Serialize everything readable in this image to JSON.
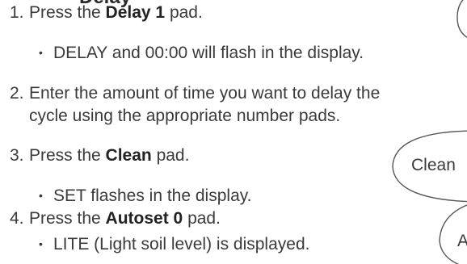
{
  "heading": {
    "fragment": "Delay"
  },
  "steps": [
    {
      "number": "1.",
      "prefix": "Press the ",
      "bold": "Delay 1",
      "suffix": " pad.",
      "bullet": "DELAY and 00:00 will flash in the display."
    },
    {
      "number": "2.",
      "line1": "Enter the amount of time you want to delay the",
      "line2": "cycle using the appropriate number pads."
    },
    {
      "number": "3.",
      "prefix": "Press the ",
      "bold": "Clean",
      "suffix": " pad.",
      "bullet": "SET flashes in the display."
    },
    {
      "number": "4.",
      "prefix": "Press the ",
      "bold": "Autoset 0",
      "suffix": " pad.",
      "bullet": "LITE (Light soil level) is displayed."
    }
  ],
  "pads": {
    "clean_label": "Clean",
    "autoset_fragment": "A"
  }
}
